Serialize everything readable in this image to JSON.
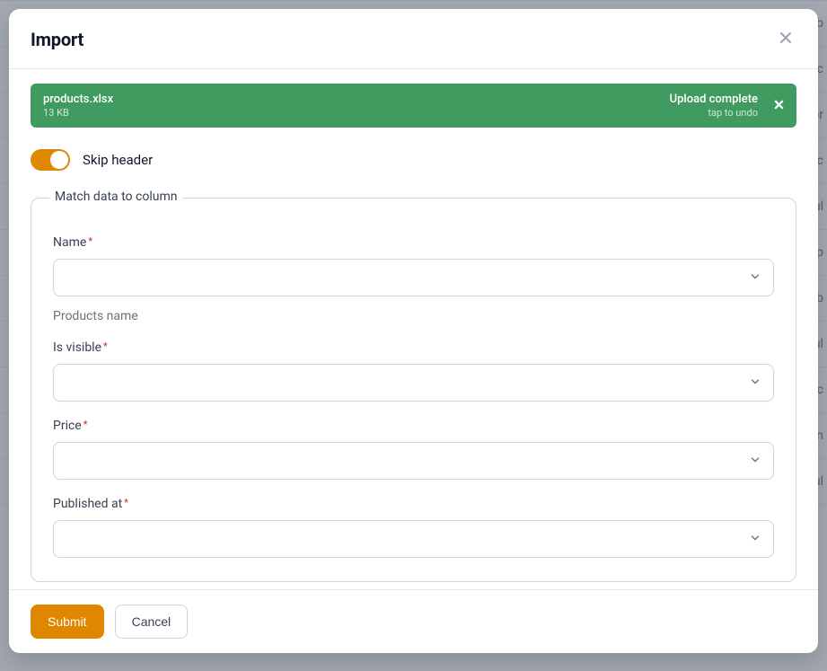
{
  "modal": {
    "title": "Import",
    "upload": {
      "filename": "products.xlsx",
      "size": "13 KB",
      "status": "Upload complete",
      "undo": "tap to undo"
    },
    "toggle_label": "Skip header",
    "fieldset": {
      "legend": "Match data to column",
      "required_mark": "*",
      "fields": {
        "name": {
          "label": "Name",
          "hint": "Products name",
          "value": ""
        },
        "is_visible": {
          "label": "Is visible",
          "value": ""
        },
        "price": {
          "label": "Price",
          "value": ""
        },
        "published_at": {
          "label": "Published at",
          "value": ""
        }
      }
    },
    "footer": {
      "submit": "Submit",
      "cancel": "Cancel"
    }
  },
  "background": {
    "rows": [
      "ub",
      "Dec",
      "Apr",
      "Dec",
      "ul",
      "Sep",
      "eb",
      "ul",
      "Dec",
      "an",
      "ul",
      ""
    ]
  }
}
